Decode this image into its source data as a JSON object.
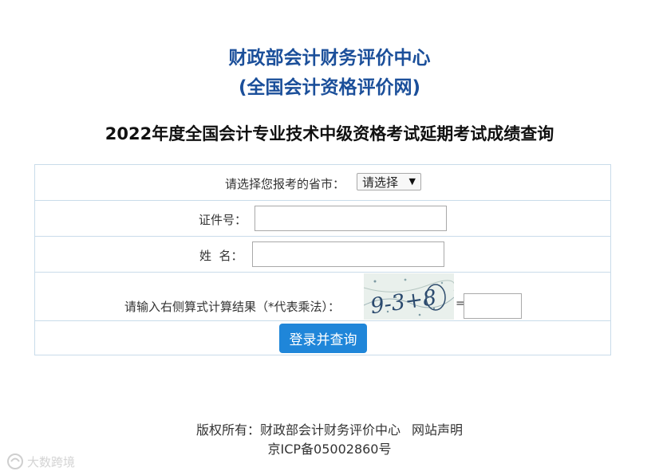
{
  "header": {
    "org_name": "财政部会计财务评价中心",
    "org_subtitle": "(全国会计资格评价网)",
    "exam_title": "2022年度全国会计专业技术中级资格考试延期考试成绩查询"
  },
  "form": {
    "province_label": "请选择您报考的省市：",
    "province_select_value": "请选择",
    "id_label": "证件号：",
    "id_value": "",
    "name_label": "姓  名：",
    "name_value": "",
    "captcha_label": "请输入右侧算式计算结果（*代表乘法）：",
    "captcha_text": "9-3+8",
    "equals_sign": "=",
    "captcha_answer": "",
    "submit_label": "登录并查询"
  },
  "footer": {
    "copyright_label": "版权所有：财政部会计财务评价中心",
    "statement_link": "网站声明",
    "icp": "京ICP备05002860号"
  },
  "watermark": {
    "text": "大数跨境"
  },
  "colors": {
    "title_blue": "#1b4f9a",
    "button_blue": "#1f86d9",
    "border": "#c9dcea"
  }
}
